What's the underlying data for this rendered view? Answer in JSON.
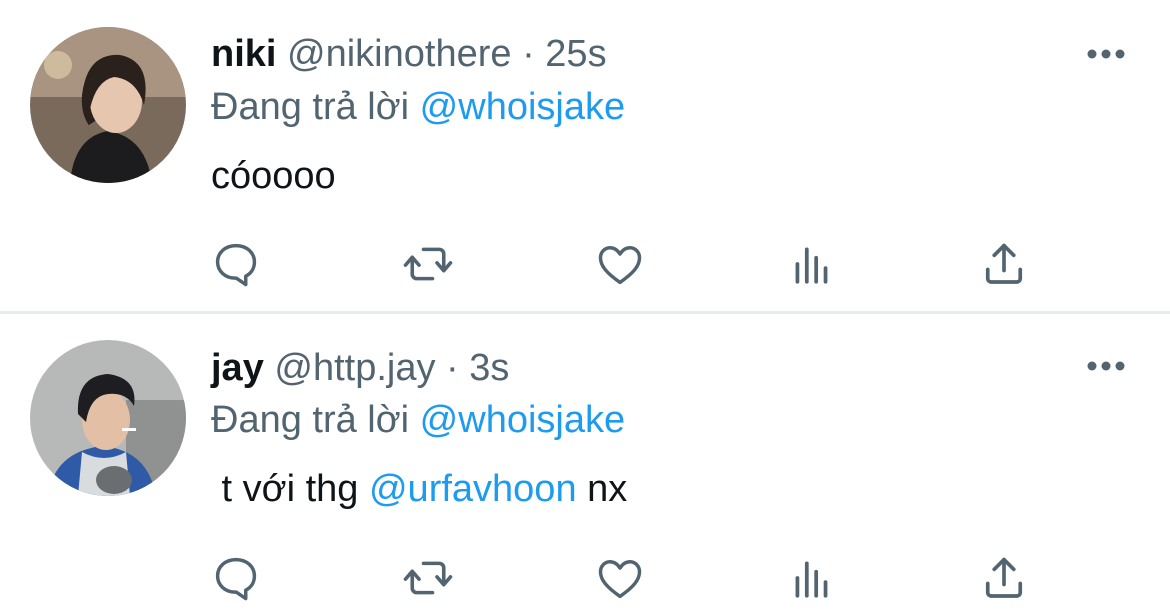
{
  "tweets": [
    {
      "name": "niki",
      "handle": "@nikinothere",
      "separator": "·",
      "time": "25s",
      "reply_prefix": "Đang trả lời",
      "reply_to": "@whoisjake",
      "body": [
        {
          "text": "cóoooo",
          "mention": false
        }
      ],
      "avatar_icon": "user-avatar-photo"
    },
    {
      "name": "jay",
      "handle": "@http.jay",
      "separator": "·",
      "time": "3s",
      "reply_prefix": "Đang trả lời",
      "reply_to": "@whoisjake",
      "body": [
        {
          "text": " t với thg ",
          "mention": false
        },
        {
          "text": "@urfavhoon",
          "mention": true
        },
        {
          "text": " nx",
          "mention": false
        }
      ],
      "avatar_icon": "user-avatar-photo"
    }
  ],
  "actions": [
    "reply-icon",
    "retweet-icon",
    "like-icon",
    "views-icon",
    "share-icon"
  ],
  "colors": {
    "text": "#0f1419",
    "secondary": "#536471",
    "accent": "#1d9bf0",
    "divider": "#e6ecf0"
  }
}
